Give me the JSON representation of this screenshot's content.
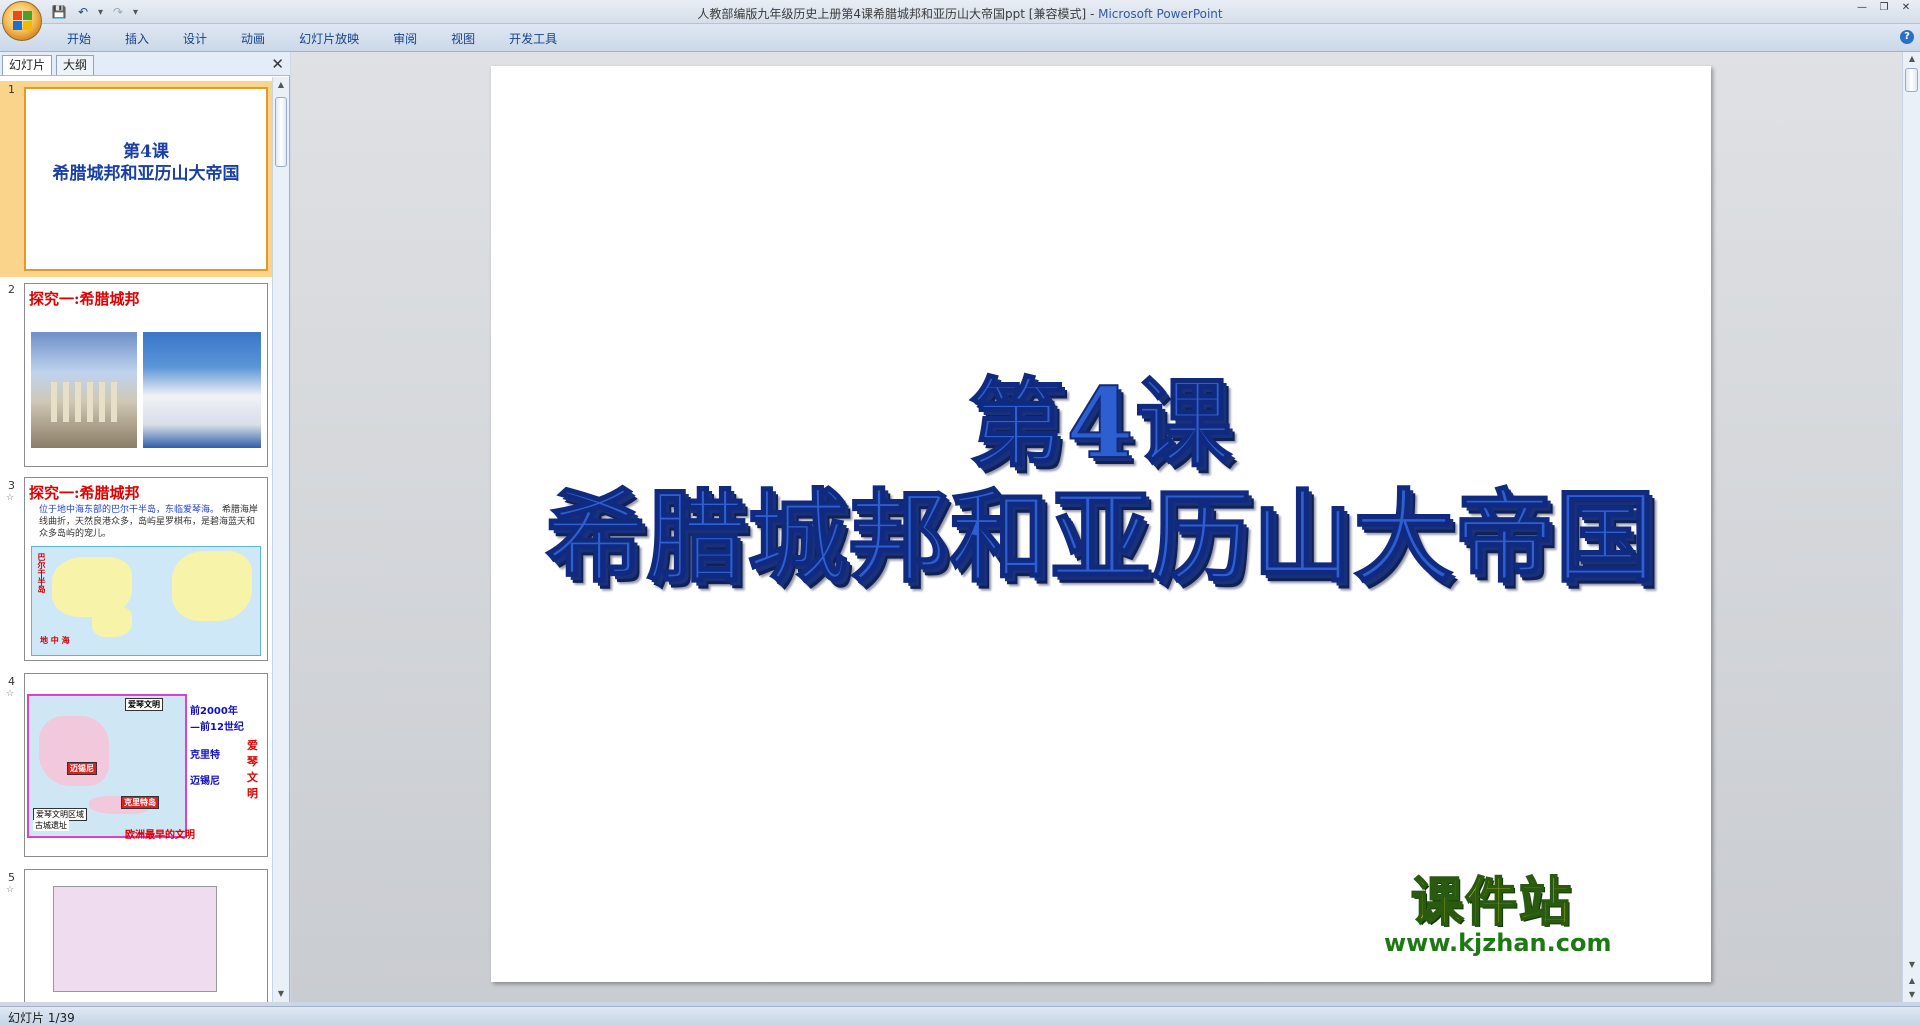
{
  "window": {
    "title_doc": "人教部编版九年级历史上册第4课希腊城邦和亚历山大帝国ppt [兼容模式]",
    "title_sep": " - ",
    "title_app": "Microsoft PowerPoint"
  },
  "ribbon": {
    "tabs": [
      "开始",
      "插入",
      "设计",
      "动画",
      "幻灯片放映",
      "审阅",
      "视图",
      "开发工具"
    ]
  },
  "panel": {
    "tabs": [
      "幻灯片",
      "大纲"
    ]
  },
  "thumbnails": [
    {
      "number": "1",
      "title_line1": "第4课",
      "title_line2": "希腊城邦和亚历山大帝国"
    },
    {
      "number": "2",
      "heading": "探究一:希腊城邦"
    },
    {
      "number": "3",
      "heading": "探究一:希腊城邦",
      "text_blue": "位于地中海东部的巴尔干半岛，东临爱琴海。",
      "text_rest": "希腊海岸线曲折，天然良港众多，岛屿星罗棋布，是碧海蓝天和众多岛屿的宠儿。",
      "map_label_side": "巴尔干半岛",
      "map_label_sea": "地 中 海"
    },
    {
      "number": "4",
      "map_tag_top": "爱琴文明",
      "map_tag_mycenae": "迈锡尼",
      "map_tag_crete": "克里特岛",
      "legend1": "爱琴文明区域",
      "legend2": "古城遗址",
      "date1": "前2000年",
      "date2": "—前12世纪",
      "crete": "克里特",
      "mycenae": "迈锡尼",
      "red_side": "爱琴文明",
      "bottom": "欧洲最早的文明"
    },
    {
      "number": "5"
    }
  ],
  "slide": {
    "title_line1": "第4课",
    "title_line2": "希腊城邦和亚历山大帝国"
  },
  "watermark": {
    "main": "课件站",
    "url": "www.kjzhan.com"
  },
  "status": {
    "slide_indicator": "幻灯片 1/39"
  }
}
